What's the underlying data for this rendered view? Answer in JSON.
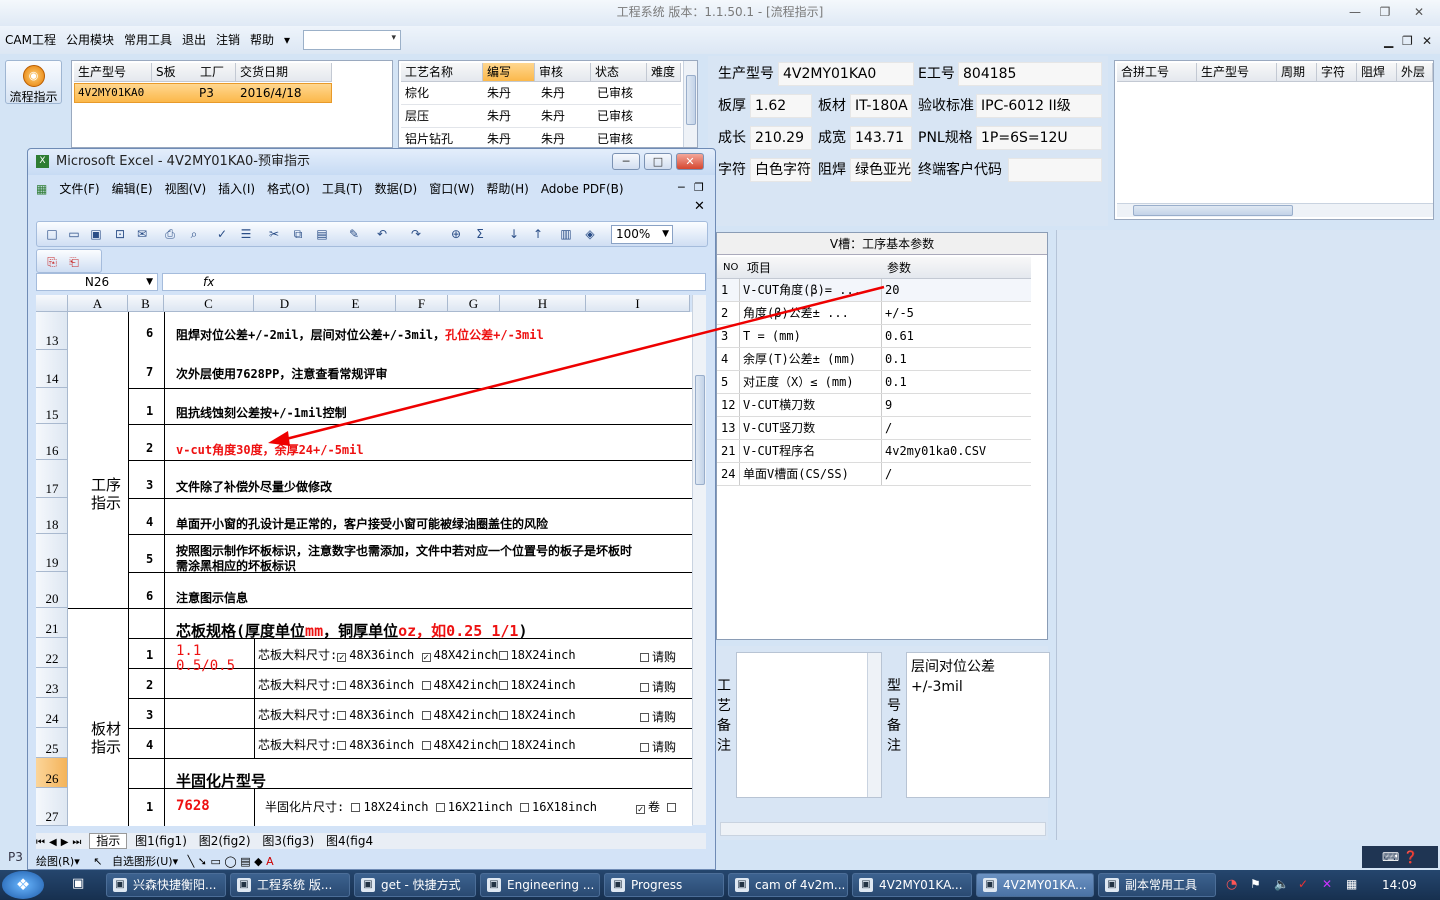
{
  "app": {
    "title": "工程系统    版本：1.1.50.1 - [流程指示]"
  },
  "menu": [
    "CAM工程",
    "公用模块",
    "常用工具",
    "退出",
    "注销",
    "帮助"
  ],
  "left_button": "流程指示",
  "grid1": {
    "headers": [
      "生产型号",
      "S板",
      "工厂",
      "交货日期"
    ],
    "row": [
      "4V2MY01KA0",
      "P3",
      "2016/4/18"
    ]
  },
  "grid2": {
    "headers": [
      "工艺名称",
      "编写",
      "审核",
      "状态",
      "难度"
    ],
    "rows": [
      [
        "棕化",
        "朱丹",
        "朱丹",
        "已审核"
      ],
      [
        "层压",
        "朱丹",
        "朱丹",
        "已审核"
      ],
      [
        "铝片钻孔",
        "朱丹",
        "朱丹",
        "已审核"
      ]
    ]
  },
  "info": {
    "l_model": "生产型号",
    "v_model": "4V2MY01KA0",
    "l_eno": "E工号",
    "v_eno": "804185",
    "l_thick": "板厚",
    "v_thick": "1.62",
    "l_mat": "板材",
    "v_mat": "IT-180A",
    "l_std": "验收标准",
    "v_std": "IPC-6012 II级",
    "l_len": "成长",
    "v_len": "210.29",
    "l_wid": "成宽",
    "v_wid": "143.71",
    "l_pnl": "PNL规格",
    "v_pnl": "1P=6S=12U",
    "l_char": "字符",
    "v_char": "白色字符",
    "l_mask": "阻焊",
    "v_mask": "绿色亚光",
    "l_cust": "终端客户代码"
  },
  "grid3": {
    "headers": [
      "合拼工号",
      "生产型号",
      "周期",
      "字符",
      "阻焊",
      "外层"
    ]
  },
  "vcut": {
    "title": "V槽：工序基本参数",
    "headers": [
      "NO",
      "项目",
      "参数"
    ],
    "rows": [
      [
        "1",
        "V-CUT角度(β)=    ...",
        "20"
      ],
      [
        "2",
        "角度(β)公差±   ...",
        "+/-5"
      ],
      [
        "3",
        "T =  (mm)",
        "0.61"
      ],
      [
        "4",
        "余厚(T)公差±  (mm)",
        "0.1"
      ],
      [
        "5",
        "对正度（X）≤ (mm)",
        "0.1"
      ],
      [
        "12",
        "V-CUT横刀数",
        "9"
      ],
      [
        "13",
        "V-CUT竖刀数",
        "/"
      ],
      [
        "21",
        "V-CUT程序名",
        "4v2my01ka0.CSV"
      ],
      [
        "24",
        "单面V槽面(CS/SS)",
        "/"
      ]
    ]
  },
  "notes": {
    "label1": [
      "工",
      "艺",
      "备",
      "注"
    ],
    "label2": [
      "型",
      "号",
      "备",
      "注"
    ],
    "text2": "层间对位公差+/-3mil"
  },
  "excel": {
    "title": "Microsoft Excel - 4V2MY01KA0-预审指示",
    "menu": [
      "文件(F)",
      "编辑(E)",
      "视图(V)",
      "插入(I)",
      "格式(O)",
      "工具(T)",
      "数据(D)",
      "窗口(W)",
      "帮助(H)",
      "Adobe PDF(B)"
    ],
    "zoom": "100%",
    "namebox": "N26",
    "fx": "fx",
    "cols": [
      "A",
      "B",
      "C",
      "D",
      "E",
      "F",
      "G",
      "H",
      "I"
    ],
    "rows": [
      "13",
      "14",
      "15",
      "16",
      "17",
      "18",
      "19",
      "20",
      "21",
      "22",
      "23",
      "24",
      "25",
      "26",
      "27"
    ],
    "sec1": "工序\n指示",
    "sec2": "板材\n指示",
    "items": [
      {
        "n": "6",
        "text": "阻焊对位公差+/-2mil，层间对位公差+/-3mil，",
        "red": "孔位公差+/-3mil"
      },
      {
        "n": "7",
        "text": "次外层使用7628PP，注意查看常规评审"
      },
      {
        "n": "1",
        "text": "阻抗线蚀刻公差按+/-1mil控制"
      },
      {
        "n": "2",
        "red": "v-cut角度30度，余厚24+/-5mil"
      },
      {
        "n": "3",
        "text": "文件除了补偿外尽量少做修改"
      },
      {
        "n": "4",
        "text": "单面开小窗的孔设计是正常的，客户接受小窗可能被绿油圈盖住的风险"
      },
      {
        "n": "5",
        "text": "按照图示制作坏板标识，注意数字也需添加，文件中若对应一个位置号的板子是坏板时",
        "text2": "需涂黑相应的坏板标识"
      },
      {
        "n": "6",
        "text": "注意图示信息"
      }
    ],
    "core_title_a": "芯板规格(厚度单位",
    "core_title_b": "mm",
    "core_title_c": "，铜厚单位",
    "core_title_d": "oz，如0.25 1/1",
    "core_title_e": ")",
    "core_rows": [
      "1",
      "2",
      "3",
      "4"
    ],
    "core_val1": "1.1",
    "core_val2": "0.5/0.5",
    "core_label": "芯板大料尺寸:",
    "opt1": "48X36inch",
    "opt2": "48X42inch",
    "opt3": "18X24inch",
    "buy": "请购",
    "pp_title": "半固化片型号",
    "pp_n": "1",
    "pp_val": "7628",
    "pp_label": "半固化片尺寸:",
    "pp1": "18X24inch",
    "pp2": "16X21inch",
    "pp3": "16X18inch",
    "roll": "卷",
    "tabs": [
      "指示",
      "图1(fig1)",
      "图2(fig2)",
      "图3(fig3)",
      "图4(fig4"
    ],
    "draw": "绘图(R)▾",
    "autoshape": "自选图形(U)▾"
  },
  "taskbar": {
    "items": [
      "兴森快捷衡阳...",
      "工程系统  版...",
      "get - 快捷方式",
      "Engineering ...",
      "Progress",
      "cam of 4v2m...",
      "4V2MY01KA...",
      "4V2MY01KA...",
      "副本常用工具"
    ],
    "clock": "14:09"
  },
  "status": "P3"
}
